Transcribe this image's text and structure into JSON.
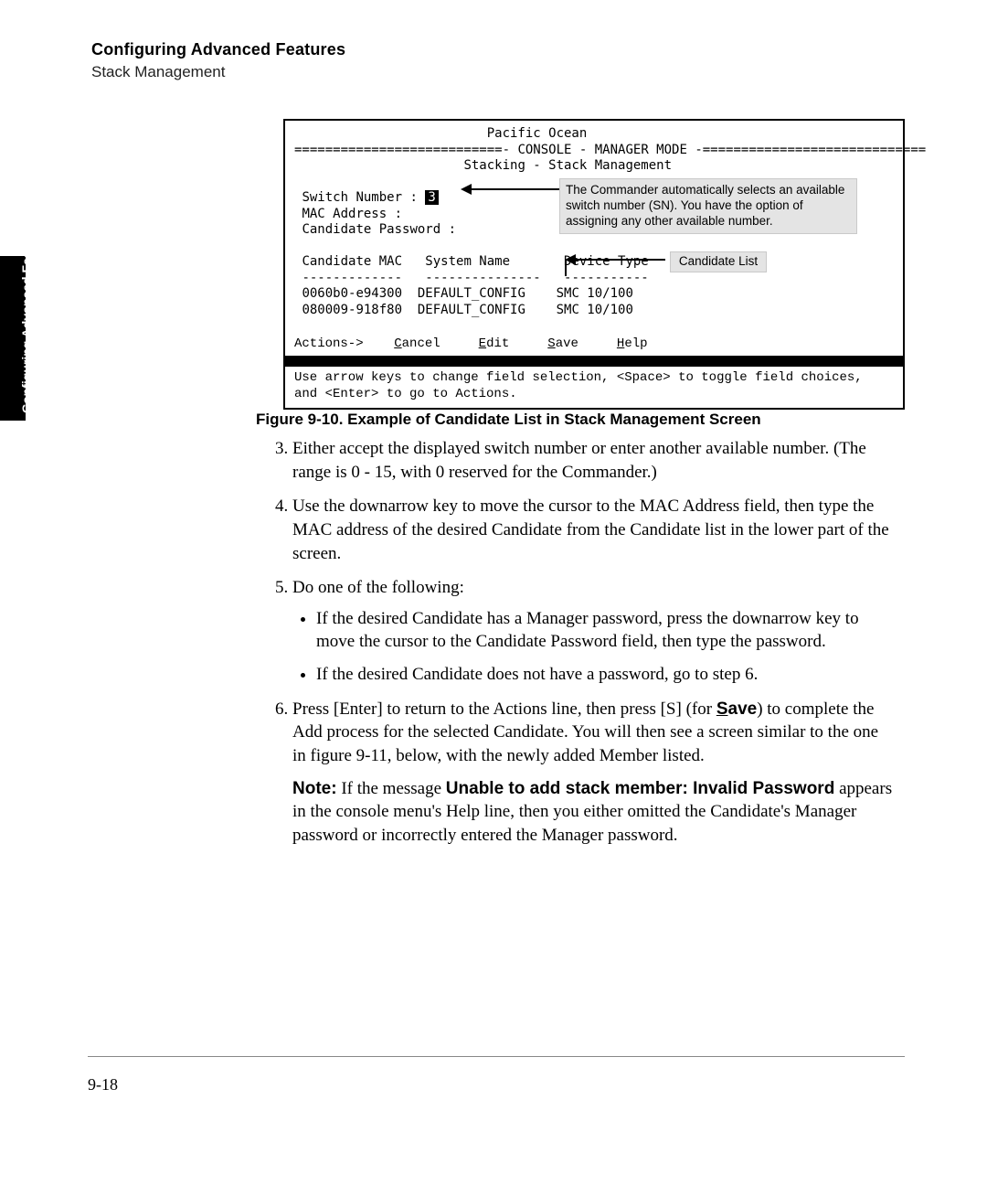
{
  "header": {
    "title": "Configuring Advanced Features",
    "subtitle": "Stack Management"
  },
  "sidetab": "Configuring Advanced Features",
  "console": {
    "title": "Pacific Ocean",
    "banner_left": "===========================-",
    "banner_mid": "CONSOLE - MANAGER MODE",
    "banner_right": "-=============================",
    "screen_title": "Stacking - Stack Management",
    "switch_label": "Switch Number :",
    "switch_value": "3",
    "mac_label": "MAC Address :",
    "cand_pw_label": "Candidate Password :",
    "table_headers": "Candidate MAC   System Name       Device Type",
    "table_sep": "-------------   ---------------   -----------",
    "rows": [
      "0060b0-e94300  DEFAULT_CONFIG    SMC 10/100",
      "080009-918f80  DEFAULT_CONFIG    SMC 10/100"
    ],
    "actions_prefix": "Actions->",
    "actions": {
      "cancel": "Cancel",
      "edit": "Edit",
      "save": "Save",
      "help": "Help"
    },
    "hint1": "Use arrow keys to change field selection, <Space> to toggle field choices,",
    "hint2": "and <Enter> to go to Actions."
  },
  "callouts": {
    "commander": "The Commander automatically selects an available switch number (SN). You have the option of assigning any other available number.",
    "candidate_list": "Candidate List"
  },
  "figure_caption": "Figure 9-10.  Example of Candidate List in Stack Management Screen",
  "list": {
    "start": 3,
    "item3": "Either accept the displayed switch number or enter another available number. (The range is 0 - 15, with 0 reserved for the Commander.)",
    "item4": "Use the downarrow key to move the cursor to the MAC Address field, then type the MAC address of the desired Candidate from the Candidate list in the lower part of the screen.",
    "item5_lead": "Do one of the following:",
    "item5_bullets": [
      "If the desired Candidate has a Manager password, press the downarrow key to move the cursor to the Candidate Password field, then type the password.",
      "If the desired Candidate does not have a password, go to step 6."
    ],
    "item6_pre": "Press [Enter] to return to the Actions line, then press [S] (for ",
    "item6_save": "Save",
    "item6_post": ") to complete the Add process for the selected Candidate. You will then see a screen similar to the one in figure 9-11, below, with the newly added Member listed.",
    "note_lead": "Note:",
    "note_err_prefix": " If the message ",
    "note_err_msg": "Unable to add stack member: Invalid Password",
    "note_tail": " appears in the console menu's Help line, then you either omitted the Candidate's Manager password or incorrectly entered the Manager password."
  },
  "page_number": "9-18"
}
